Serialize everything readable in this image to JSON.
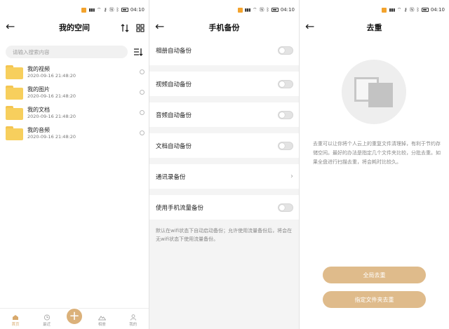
{
  "status": {
    "time": "04:10",
    "signal": "ᵢᵢ.ᵢᵢ"
  },
  "screen1": {
    "title": "我的空间",
    "search_placeholder": "请输入搜索内容",
    "files": [
      {
        "name": "我的视频",
        "date": "2020-09-16 21:48:20"
      },
      {
        "name": "我的图片",
        "date": "2020-09-16 21:48:20"
      },
      {
        "name": "我的文档",
        "date": "2020-09-16 21:48:20"
      },
      {
        "name": "我的音频",
        "date": "2020-09-16 21:48:20"
      }
    ],
    "nav": {
      "home": "首页",
      "recent": "最近",
      "album": "相册",
      "mine": "我的"
    }
  },
  "screen2": {
    "title": "手机备份",
    "rows": {
      "album": "相册自动备份",
      "video": "视频自动备份",
      "audio": "音频自动备份",
      "doc": "文档自动备份",
      "contacts": "通讯录备份",
      "mobile_data": "使用手机流量备份"
    },
    "note": "默认在wifi状态下自动启动备份；允许使用流量备份后，将会在无wifi状态下使用流量备份。"
  },
  "screen3": {
    "title": "去重",
    "description": "去重可以让你将个人云上的重复文件清理掉，有利于节约存储空间。最好的办法是指定几个文件夹比较，分批去重。如果全盘进行扫描去重，将会耗时比较久。",
    "btn_global": "全局去重",
    "btn_folder": "指定文件夹去重"
  },
  "colors": {
    "accent": "#dbb17a",
    "folder": "#f7cf5d",
    "background_gray": "#f4f4f4"
  }
}
